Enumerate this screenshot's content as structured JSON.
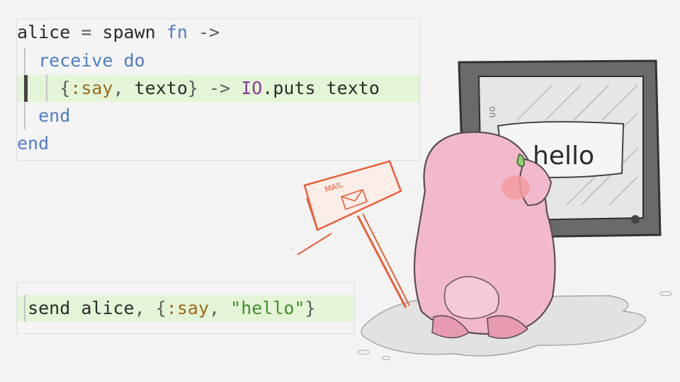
{
  "top_snippet": {
    "line1": {
      "var": "alice",
      "eq": "=",
      "fn_call": "spawn",
      "kw_fn": "fn",
      "arrow": "->"
    },
    "line2": {
      "kw_receive": "receive",
      "kw_do": "do"
    },
    "line3": {
      "open": "{",
      "atom": ":say",
      "comma": ",",
      "var": "texto",
      "close": "}",
      "arrow": "->",
      "module": "IO",
      "call": ".puts",
      "arg": "texto"
    },
    "line4": {
      "kw_end": "end"
    },
    "line5": {
      "kw_end": "end"
    }
  },
  "bottom_snippet": {
    "send": "send",
    "target": "alice",
    "comma1": ",",
    "open": "{",
    "atom": ":say",
    "comma2": ",",
    "str": "\"hello\"",
    "close": "}"
  },
  "illustration": {
    "screen_text": "hello",
    "sign_text": "MAIL",
    "screen_side_text": "on"
  },
  "colors": {
    "highlight": "#e3f5d6",
    "keyword": "#4f7ec6",
    "atom": "#9b6a1d",
    "module": "#8a3a9c",
    "string": "#3f8f2a",
    "sign": "#e85f3a",
    "character": "#f2b8cc"
  }
}
